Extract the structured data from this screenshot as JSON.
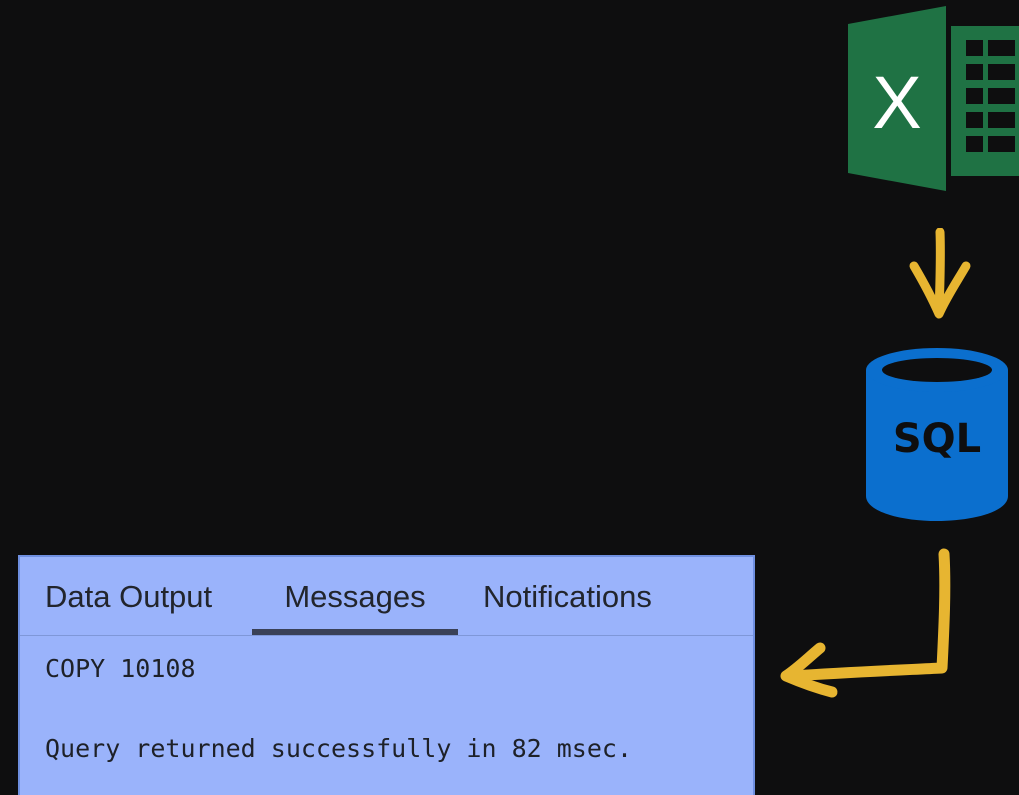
{
  "panel": {
    "tabs": [
      {
        "label": "Data Output",
        "active": false
      },
      {
        "label": "Messages",
        "active": true
      },
      {
        "label": "Notifications",
        "active": false
      }
    ],
    "messages": [
      "COPY 10108",
      "Query returned successfully in 82 msec."
    ]
  },
  "icons": {
    "excel": {
      "name": "excel-icon",
      "letter": "X",
      "color": "#1f7244"
    },
    "sql": {
      "name": "sql-database-icon",
      "label": "SQL",
      "color": "#0b6fce"
    },
    "arrows": {
      "color": "#e7b531"
    }
  }
}
